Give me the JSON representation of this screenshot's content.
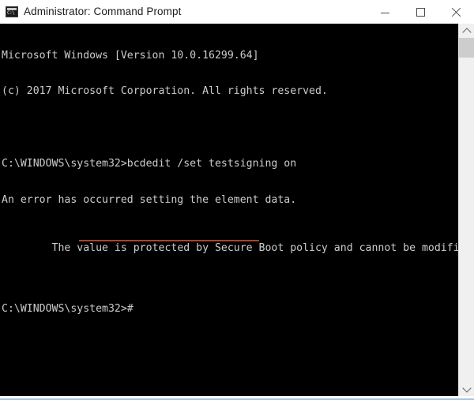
{
  "window": {
    "title": "Administrator: Command Prompt",
    "icon": "command-prompt-icon",
    "controls": {
      "minimize_label": "Minimize",
      "maximize_label": "Maximize",
      "close_label": "Close"
    }
  },
  "console": {
    "background_color": "#000000",
    "text_color": "#cccccc",
    "highlight_color": "#a6442a",
    "lines": [
      "Microsoft Windows [Version 10.0.16299.64]",
      "(c) 2017 Microsoft Corporation. All rights reserved.",
      "",
      "C:\\WINDOWS\\system32>bcdedit /set testsigning on",
      "An error has occurred setting the element data.",
      "The value is protected by Secure Boot policy and cannot be modified or deleted.",
      "",
      "C:\\WINDOWS\\system32>#"
    ],
    "annotation": {
      "type": "red-underline",
      "underlined_text": "protected by Secure Boot policy",
      "color": "#a6442a"
    }
  },
  "scrollbar": {
    "up_arrow": "chevron-up-icon",
    "down_arrow": "chevron-down-icon",
    "thumb_color": "#cdcdcd",
    "track_color": "#f0f0f0"
  }
}
